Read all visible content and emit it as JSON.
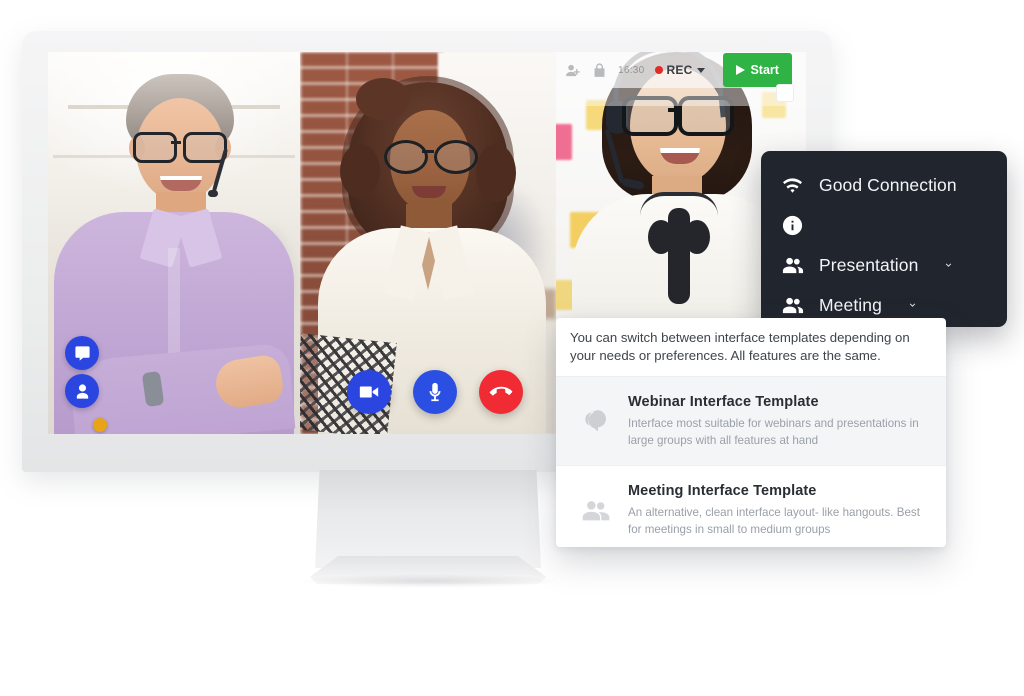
{
  "meta": {
    "accent_blue": "#2b46e0",
    "accent_red": "#f02b33",
    "accent_green": "#2fb344",
    "dark_panel_bg": "#21262e"
  },
  "toolbar": {
    "icons": [
      "add-user-icon",
      "lock-icon"
    ],
    "timer": "16:30",
    "rec_label": "REC",
    "start_label": "Start"
  },
  "side_buttons": [
    {
      "name": "chat-button",
      "icon": "chat-bubble-icon"
    },
    {
      "name": "participants-button",
      "icon": "person-icon",
      "badge": true
    }
  ],
  "call_controls": [
    {
      "name": "camera-button",
      "icon": "video-camera-icon",
      "color": "#2b46e0"
    },
    {
      "name": "microphone-button",
      "icon": "microphone-icon",
      "color": "#2b4fe3"
    },
    {
      "name": "end-call-button",
      "icon": "phone-hangup-icon",
      "color": "#f02b33"
    }
  ],
  "settings_panel": {
    "rows": [
      {
        "icon": "wifi-icon",
        "label": "Good Connection",
        "chevron": false
      },
      {
        "icon": "info-icon",
        "label": "",
        "chevron": false
      },
      {
        "icon": "people-icon",
        "label": "Presentation",
        "chevron": true
      },
      {
        "icon": "people-icon",
        "label": "Meeting",
        "chevron": true
      }
    ]
  },
  "templates_dropdown": {
    "header": "You can switch between interface templates depending on your needs or preferences. All features are the same.",
    "items": [
      {
        "icon": "chat-bubbles-icon",
        "title": "Webinar Interface Template",
        "description": "Interface most suitable for webinars and presentations in large groups with all features at hand",
        "selected": true
      },
      {
        "icon": "two-people-icon",
        "title": "Meeting Interface Template",
        "description": "An alternative, clean interface layout- like hangouts. Best for meetings in small to medium groups",
        "selected": false
      }
    ]
  },
  "video_panels": [
    {
      "name": "participant-tile-1"
    },
    {
      "name": "participant-tile-2"
    },
    {
      "name": "participant-tile-3"
    }
  ]
}
